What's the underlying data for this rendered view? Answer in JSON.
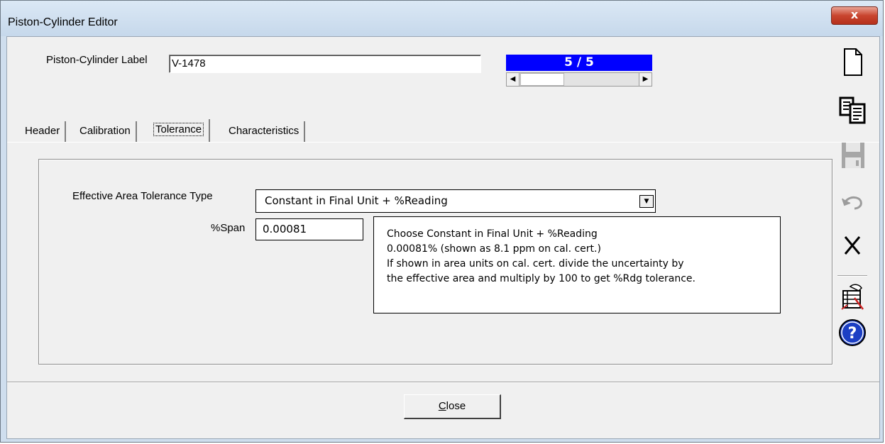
{
  "window": {
    "title": "Piston-Cylinder Editor",
    "close_glyph": "x"
  },
  "header": {
    "label_text": "Piston-Cylinder Label",
    "label_value": "V-1478",
    "record_position": "5 / 5",
    "record_position_fraction": 1.0
  },
  "tabs": [
    {
      "label": "Header",
      "active": false
    },
    {
      "label": "Calibration",
      "active": false
    },
    {
      "label": "Tolerance",
      "active": true
    },
    {
      "label": "Characteristics",
      "active": false
    }
  ],
  "tolerance": {
    "type_label": "Effective Area Tolerance Type",
    "type_value": "Constant in Final Unit + %Reading",
    "span_label": "%Span",
    "span_value": "0.00081",
    "note_lines": [
      "Choose Constant in Final Unit + %Reading",
      "0.00081% (shown as 8.1 ppm on cal. cert.)",
      "If shown in area units on cal. cert. divide the uncertainty by",
      "the effective area and multiply by 100 to get %Rdg tolerance."
    ]
  },
  "footer": {
    "close_label": "Close"
  },
  "toolbar": {
    "icons": [
      "new-document-icon",
      "copy-icon",
      "save-icon",
      "undo-icon",
      "delete-icon",
      "edit-record-icon",
      "help-icon"
    ],
    "disabled": [
      "save-icon",
      "undo-icon"
    ],
    "help_glyph": "?"
  },
  "colors": {
    "record_box": "#0000ff",
    "help_icon": "#1c3fc4",
    "title_close": "#c9452f"
  }
}
